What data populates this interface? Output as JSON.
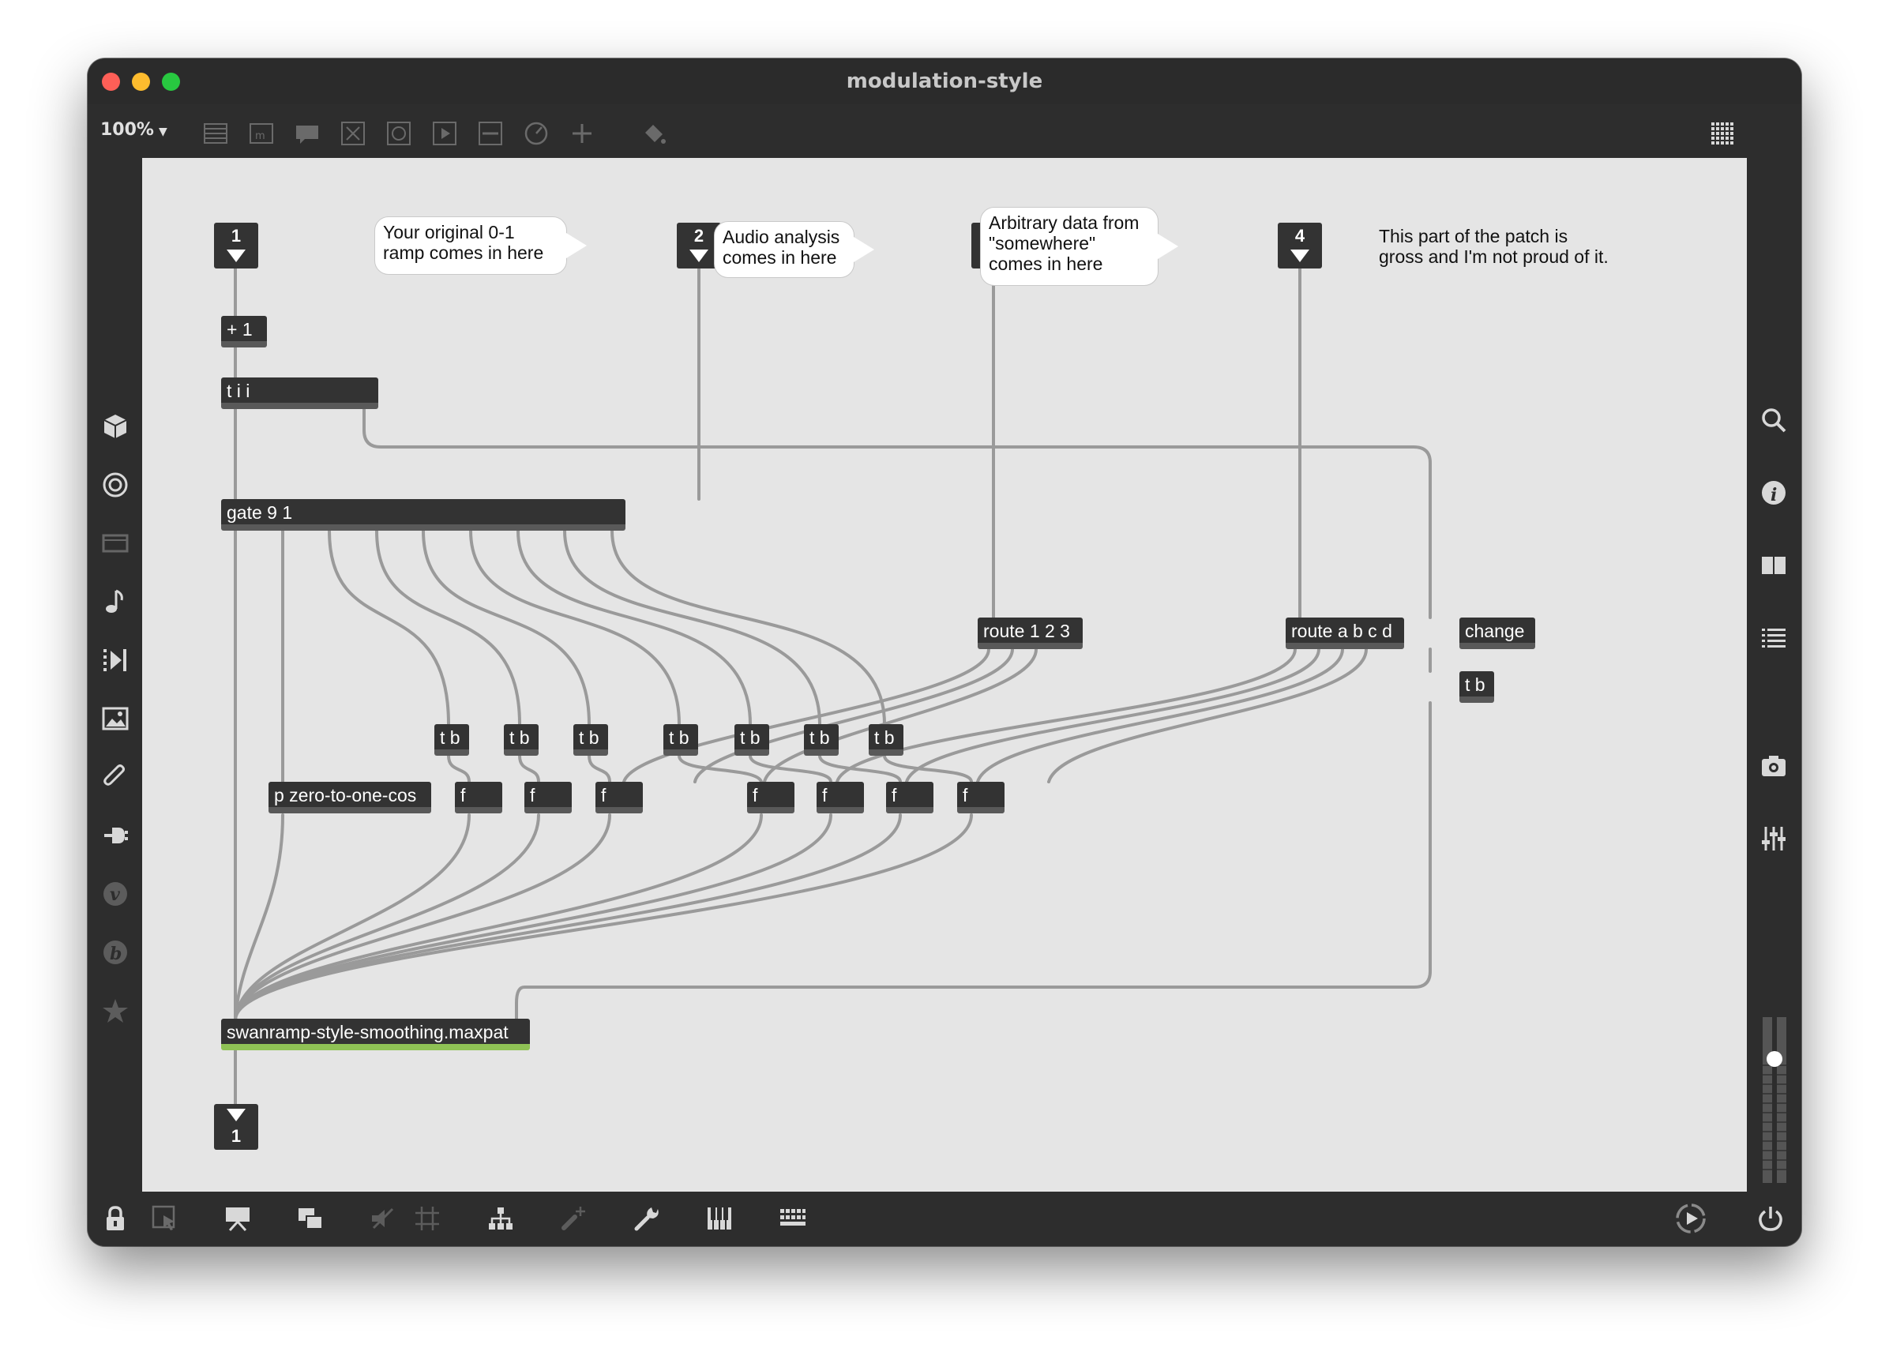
{
  "window": {
    "title": "modulation-style",
    "zoom": "100%"
  },
  "toolbar": {
    "icons": [
      "object-box-icon",
      "message-icon",
      "comment-icon",
      "toggle-icon",
      "button-icon",
      "bang-play-icon",
      "slider-icon",
      "dial-icon",
      "add-icon",
      "paint-bucket-icon",
      "grid-view-icon"
    ]
  },
  "left_sidebar": {
    "icons": [
      "cube-icon",
      "target-icon",
      "monitor-icon",
      "music-note-icon",
      "step-sequence-icon",
      "image-icon",
      "paperclip-icon",
      "plug-icon",
      "v-icon",
      "b-icon",
      "star-icon"
    ]
  },
  "right_sidebar": {
    "icons": [
      "search-icon",
      "info-icon",
      "book-icon",
      "list-icon",
      "camera-icon",
      "mixer-icon",
      "volume-slider-icon"
    ]
  },
  "bottom_bar": {
    "icons": [
      "lock-icon",
      "edit-pointer-icon",
      "presentation-icon",
      "layers-icon",
      "hide-icon",
      "grid-icon",
      "tree-icon",
      "add-link-icon",
      "wrench-icon",
      "piano-icon",
      "keyboard-icon",
      "play-circle-icon",
      "power-icon"
    ]
  },
  "patch": {
    "inlets": [
      "1",
      "2",
      "3",
      "4"
    ],
    "outlets": [
      "1"
    ],
    "comments": {
      "c1": "Your original 0-1\nramp comes in here",
      "c2": "Audio analysis\ncomes in here",
      "c3": "Arbitrary data from\n\"somewhere\"\ncomes in here",
      "c4": "This part of the patch is\ngross and I'm not proud of it."
    },
    "objects": {
      "plus1": "+ 1",
      "tii": "t i i",
      "gate": "gate 9 1",
      "route123": "route 1 2 3",
      "routeabcd": "route a b c d",
      "change": "change",
      "tb": "t b",
      "zero": "p zero-to-one-cos",
      "f": "f",
      "swanramp": "swanramp-style-smoothing.maxpat"
    }
  }
}
